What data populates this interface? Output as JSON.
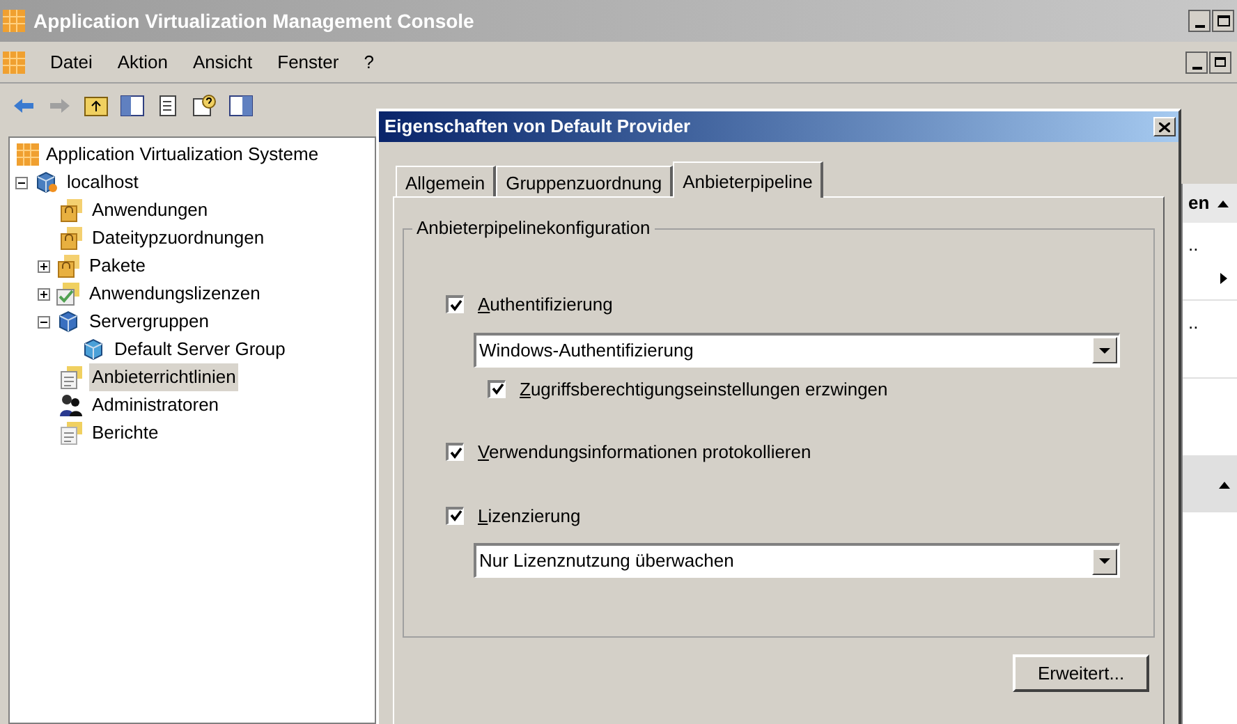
{
  "window": {
    "title": "Application Virtualization Management Console"
  },
  "menu": [
    {
      "label": "Datei"
    },
    {
      "label": "Aktion"
    },
    {
      "label": "Ansicht"
    },
    {
      "label": "Fenster"
    },
    {
      "label": "?"
    }
  ],
  "tree": [
    {
      "label": "Application Virtualization Systeme",
      "kind": "root",
      "selected": false,
      "children": [
        {
          "label": "localhost",
          "kind": "host",
          "expanded": true,
          "selected": false,
          "children": [
            {
              "label": "Anwendungen",
              "kind": "folder",
              "selected": false
            },
            {
              "label": "Dateitypzuordnungen",
              "kind": "folder",
              "selected": false
            },
            {
              "label": "Pakete",
              "kind": "package",
              "expanded": false,
              "selected": false
            },
            {
              "label": "Anwendungslizenzen",
              "kind": "license",
              "expanded": false,
              "selected": false
            },
            {
              "label": "Servergruppen",
              "kind": "servers",
              "expanded": true,
              "selected": false,
              "children": [
                {
                  "label": "Default Server Group",
                  "kind": "group",
                  "selected": false
                }
              ]
            },
            {
              "label": "Anbieterrichtlinien",
              "kind": "policy",
              "selected": true
            },
            {
              "label": "Administratoren",
              "kind": "admins",
              "selected": false
            },
            {
              "label": "Berichte",
              "kind": "reports",
              "selected": false
            }
          ]
        }
      ]
    }
  ],
  "actions_pane": {
    "header": "en",
    "rows": [
      "..",
      "..",
      ""
    ]
  },
  "dialog": {
    "title": "Eigenschaften von Default Provider",
    "tabs": [
      {
        "label": "Allgemein",
        "selected": false
      },
      {
        "label": "Gruppenzuordnung",
        "selected": false
      },
      {
        "label": "Anbieterpipeline",
        "selected": true
      }
    ],
    "group_title": "Anbieterpipelinekonfiguration",
    "options": [
      {
        "kind": "checkbox",
        "label": "Authentifizierung",
        "checked": true,
        "indent": false
      },
      {
        "kind": "dropdown",
        "value": "Windows-Authentifizierung"
      },
      {
        "kind": "checkbox",
        "label": "Zugriffsberechtigungseinstellungen erzwingen",
        "checked": true,
        "indent": true
      },
      {
        "kind": "checkbox",
        "label": "Verwendungsinformationen protokollieren",
        "checked": true,
        "indent": false
      },
      {
        "kind": "checkbox",
        "label": "Lizenzierung",
        "checked": true,
        "indent": false
      },
      {
        "kind": "dropdown",
        "value": "Nur Lizenznutzung überwachen"
      }
    ],
    "button": "Erweitert..."
  }
}
